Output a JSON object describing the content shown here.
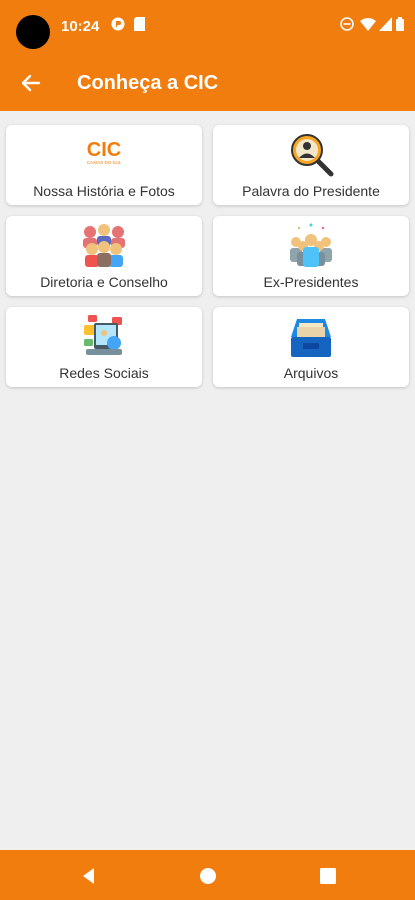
{
  "status": {
    "time": "10:24"
  },
  "appbar": {
    "title": "Conheça a CIC"
  },
  "cards": [
    {
      "label": "Nossa História e Fotos",
      "icon": "cic-logo-icon",
      "logo_text": "CIC",
      "logo_sub": "CAXIAS DO SUL"
    },
    {
      "label": "Palavra do Presidente",
      "icon": "magnifier-person-icon"
    },
    {
      "label": "Diretoria e Conselho",
      "icon": "team-icon"
    },
    {
      "label": "Ex-Presidentes",
      "icon": "group-people-icon"
    },
    {
      "label": "Redes Sociais",
      "icon": "social-media-icon"
    },
    {
      "label": "Arquivos",
      "icon": "archive-box-icon"
    }
  ],
  "colors": {
    "primary": "#f07d0e",
    "background": "#efefef",
    "card": "#ffffff"
  }
}
